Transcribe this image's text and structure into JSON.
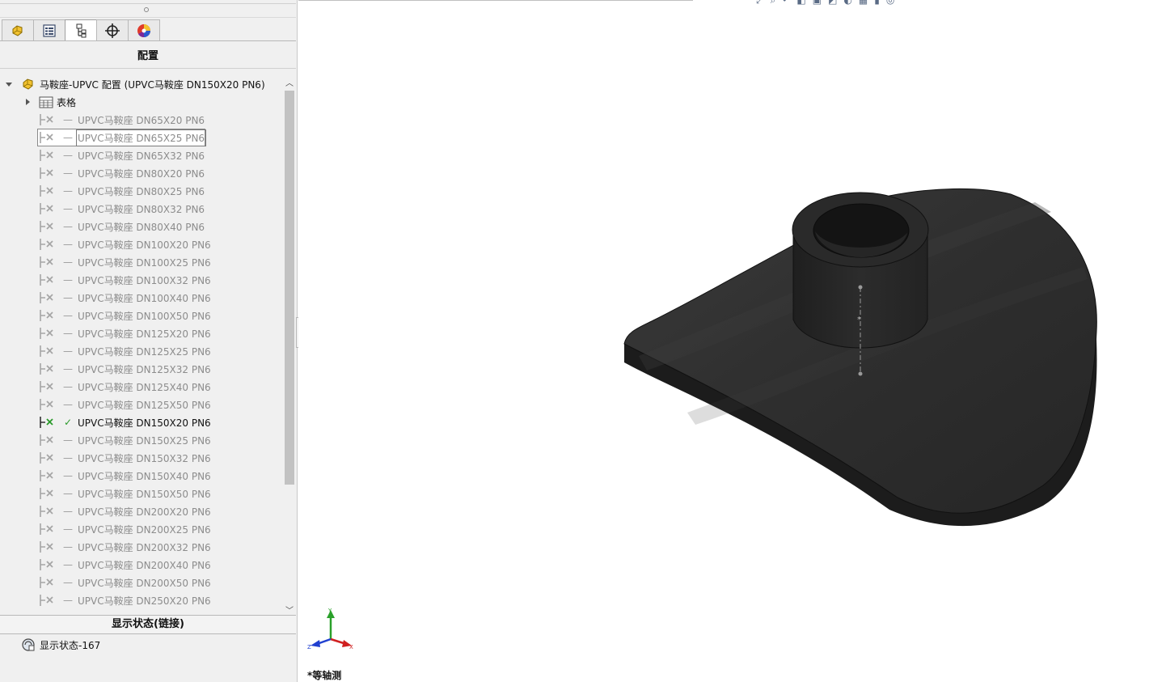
{
  "panel": {
    "title": "配置",
    "tabs": [
      {
        "name": "featuremanager-tab"
      },
      {
        "name": "propertymanager-tab"
      },
      {
        "name": "configurationmanager-tab"
      },
      {
        "name": "dimxpert-tab"
      },
      {
        "name": "display-manager-tab"
      }
    ],
    "root_label": "马鞍座-UPVC 配置  (UPVC马鞍座 DN150X20 PN6)",
    "table_label": "表格",
    "configurations": [
      {
        "label": "UPVC马鞍座 DN65X20 PN6",
        "state": "—"
      },
      {
        "label": "UPVC马鞍座 DN65X25 PN6",
        "state": "—",
        "selected": true
      },
      {
        "label": "UPVC马鞍座 DN65X32 PN6",
        "state": "—"
      },
      {
        "label": "UPVC马鞍座 DN80X20 PN6",
        "state": "—"
      },
      {
        "label": "UPVC马鞍座 DN80X25 PN6",
        "state": "—"
      },
      {
        "label": "UPVC马鞍座 DN80X32 PN6",
        "state": "—"
      },
      {
        "label": "UPVC马鞍座 DN80X40 PN6",
        "state": "—"
      },
      {
        "label": "UPVC马鞍座 DN100X20 PN6",
        "state": "—"
      },
      {
        "label": "UPVC马鞍座 DN100X25 PN6",
        "state": "—"
      },
      {
        "label": "UPVC马鞍座 DN100X32 PN6",
        "state": "—"
      },
      {
        "label": "UPVC马鞍座 DN100X40 PN6",
        "state": "—"
      },
      {
        "label": "UPVC马鞍座 DN100X50 PN6",
        "state": "—"
      },
      {
        "label": "UPVC马鞍座 DN125X20 PN6",
        "state": "—"
      },
      {
        "label": "UPVC马鞍座 DN125X25 PN6",
        "state": "—"
      },
      {
        "label": "UPVC马鞍座 DN125X32 PN6",
        "state": "—"
      },
      {
        "label": "UPVC马鞍座 DN125X40 PN6",
        "state": "—"
      },
      {
        "label": "UPVC马鞍座 DN125X50 PN6",
        "state": "—"
      },
      {
        "label": "UPVC马鞍座 DN150X20 PN6",
        "state": "✓",
        "active": true
      },
      {
        "label": "UPVC马鞍座 DN150X25 PN6",
        "state": "—"
      },
      {
        "label": "UPVC马鞍座 DN150X32 PN6",
        "state": "—"
      },
      {
        "label": "UPVC马鞍座 DN150X40 PN6",
        "state": "—"
      },
      {
        "label": "UPVC马鞍座 DN150X50 PN6",
        "state": "—"
      },
      {
        "label": "UPVC马鞍座 DN200X20 PN6",
        "state": "—"
      },
      {
        "label": "UPVC马鞍座 DN200X25 PN6",
        "state": "—"
      },
      {
        "label": "UPVC马鞍座 DN200X32 PN6",
        "state": "—"
      },
      {
        "label": "UPVC马鞍座 DN200X40 PN6",
        "state": "—"
      },
      {
        "label": "UPVC马鞍座 DN200X50 PN6",
        "state": "—"
      },
      {
        "label": "UPVC马鞍座 DN250X20 PN6",
        "state": "—"
      }
    ],
    "display_states_header": "显示状态(链接)",
    "display_state": "显示状态-167"
  },
  "viewport": {
    "view_name": "*等轴测",
    "triad": {
      "y": "Y",
      "x": "X",
      "z": "Z"
    },
    "model_color": "#2b2b2b"
  },
  "colors": {
    "panel_bg": "#f0f0f0",
    "inactive_text": "#8c8c8c",
    "check_green": "#2a9a2a"
  }
}
